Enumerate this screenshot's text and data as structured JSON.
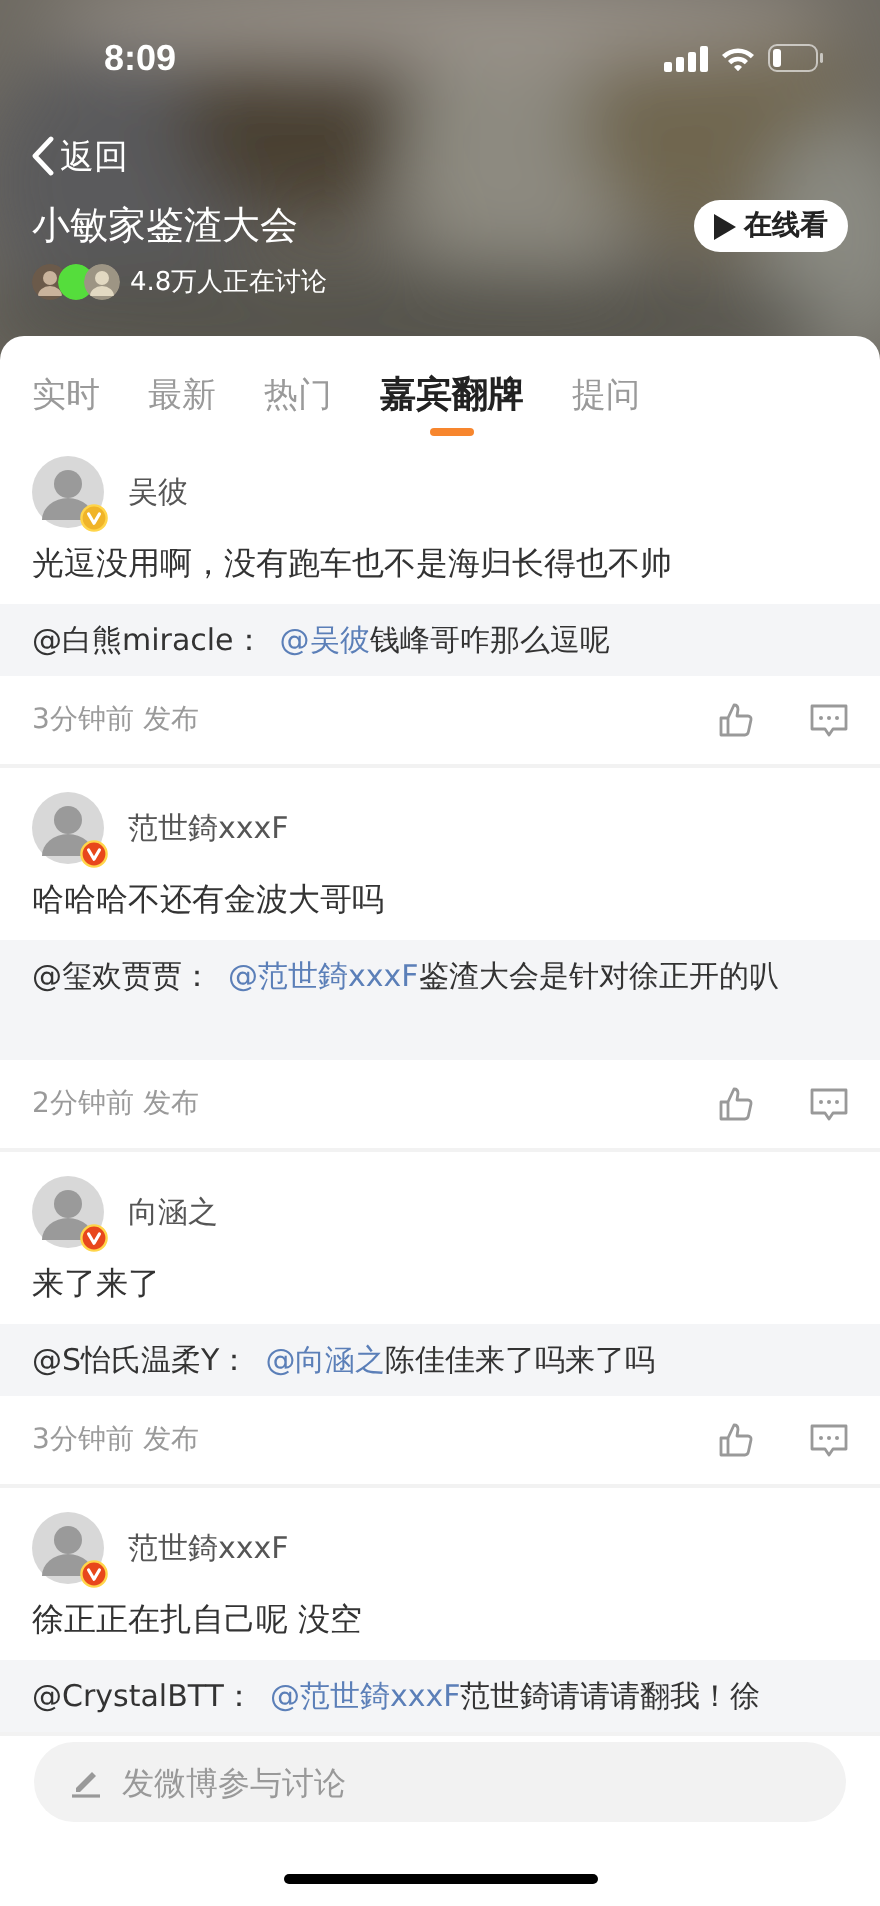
{
  "status_bar": {
    "time": "8:09"
  },
  "header": {
    "back": "返回",
    "title": "小敏家鉴渣大会",
    "watch_button": "在线看",
    "discussing": "4.8万人正在讨论"
  },
  "tabs": [
    {
      "label": "实时",
      "selected": false
    },
    {
      "label": "最新",
      "selected": false
    },
    {
      "label": "热门",
      "selected": false
    },
    {
      "label": "嘉宾翻牌",
      "selected": true
    },
    {
      "label": "提问",
      "selected": false
    }
  ],
  "posts": [
    {
      "author": "吴彼",
      "color": "#f0b429",
      "text": "光逗没用啊，没有跑车也不是海归长得也不帅",
      "reply": {
        "author": "@白熊miracle：",
        "mention": "@吴彼",
        "text": "钱峰哥咋那么逗呢",
        "tall": false
      },
      "time": "3分钟前 发布"
    },
    {
      "author": "范世錡xxxF",
      "color": "#e8471c",
      "text": "哈哈哈不还有金波大哥吗",
      "reply": {
        "author": "@玺欢贾贾：",
        "mention": "@范世錡xxxF",
        "text": "鉴渣大会是针对徐正开的叭",
        "tall": true
      },
      "time": "2分钟前 发布"
    },
    {
      "author": "向涵之",
      "color": "#e8471c",
      "text": "来了来了",
      "reply": {
        "author": "@S怡氏温柔Y：",
        "mention": "@向涵之",
        "text": "陈佳佳来了吗来了吗",
        "tall": false
      },
      "time": "3分钟前 发布"
    },
    {
      "author": "范世錡xxxF",
      "color": "#e8471c",
      "text": "徐正正在扎自己呢 没空",
      "reply": {
        "author": "@CrystalBTT：",
        "mention": "@范世錡xxxF",
        "text": "范世錡请请请翻我！徐",
        "tall": false
      }
    }
  ],
  "composer": {
    "placeholder": "发微博参与讨论"
  }
}
